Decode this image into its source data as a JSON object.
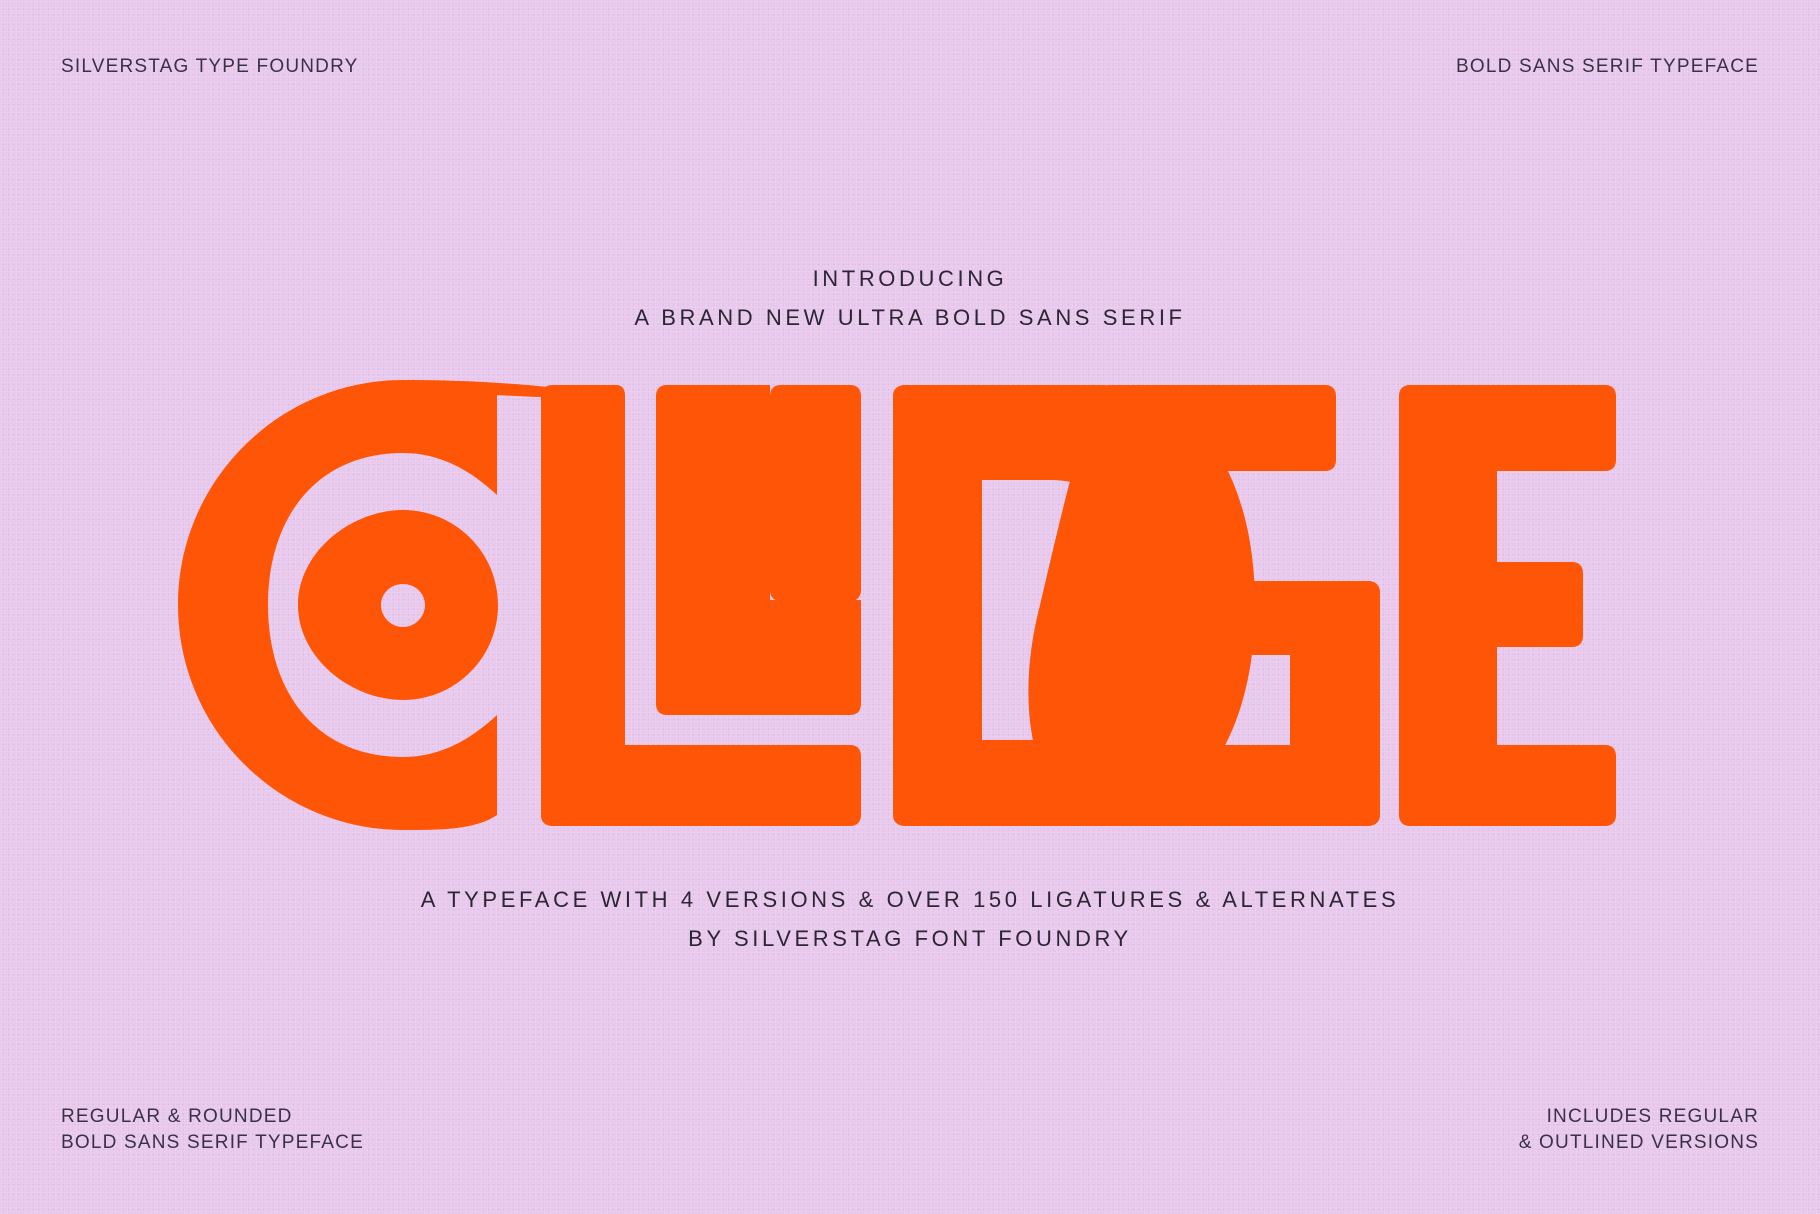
{
  "corners": {
    "top_left": "SILVERSTAG TYPE FOUNDRY",
    "top_right": "BOLD SANS SERIF TYPEFACE",
    "bottom_left": [
      "REGULAR & ROUNDED",
      "BOLD SANS SERIF TYPEFACE"
    ],
    "bottom_right": [
      "INCLUDES REGULAR",
      "& OUTLINED VERSIONS"
    ]
  },
  "intro": {
    "line1": "INTRODUCING",
    "line2": "A BRAND NEW ULTRA BOLD SANS SERIF"
  },
  "wordmark": {
    "text": "COLLIDGE",
    "color": "#ff5507"
  },
  "tagline": {
    "line1": "A TYPEFACE WITH 4 VERSIONS & OVER 150 LIGATURES & ALTERNATES",
    "line2": "BY SILVERSTAG FONT FOUNDRY"
  },
  "colors": {
    "background": "#e8c8ec",
    "text": "#3a3147",
    "accent": "#ff5507"
  }
}
